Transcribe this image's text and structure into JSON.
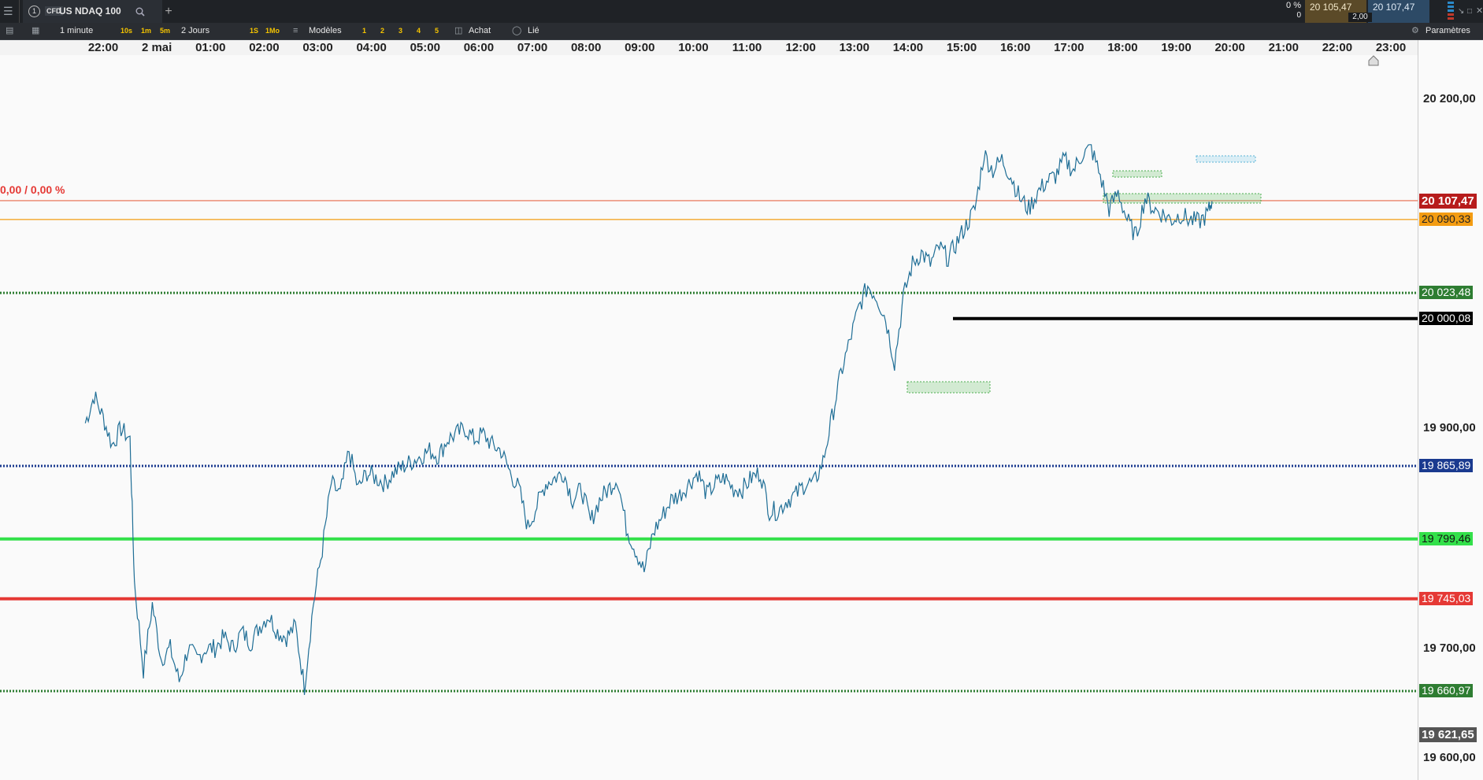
{
  "instrument": {
    "type_badge": "CFD",
    "name": "US NDAQ 100",
    "add_tab": "+"
  },
  "quote": {
    "change_pct": "0 %",
    "change_abs": "0",
    "bid": "20 105,47",
    "ask": "20 107,47",
    "spread": "2,00"
  },
  "toolbar": {
    "interval": "1 minute",
    "quick_intervals": [
      "10s",
      "1m",
      "5m"
    ],
    "range": "2 Jours",
    "quick_ranges": [
      "1S",
      "1Mo"
    ],
    "templates_label": "Modèles",
    "layouts": [
      "1",
      "2",
      "3",
      "4",
      "5"
    ],
    "buy_label": "Achat",
    "link_label": "Lié",
    "settings_label": "Paramètres"
  },
  "time_axis": [
    "22:00",
    "2 mai",
    "01:00",
    "02:00",
    "03:00",
    "04:00",
    "05:00",
    "06:00",
    "07:00",
    "08:00",
    "09:00",
    "10:00",
    "11:00",
    "12:00",
    "13:00",
    "14:00",
    "15:00",
    "16:00",
    "17:00",
    "18:00",
    "19:00",
    "20:00",
    "21:00",
    "22:00",
    "23:00"
  ],
  "price_axis": [
    "20 200,00",
    "19 900,00",
    "19 700,00",
    "19 600,00"
  ],
  "change_readout": "0,00 / 0,00 %",
  "levels": [
    {
      "price": 20107.47,
      "label": "20 107,47",
      "style": "last",
      "line": "#e8694a",
      "tag_bg": "#b71c1c",
      "tag_fg": "#ffffff"
    },
    {
      "price": 20090.33,
      "label": "20 090,33",
      "style": "solid-thin",
      "line": "#f39c12",
      "tag_bg": "#f39c12",
      "tag_fg": "#222222"
    },
    {
      "price": 20023.48,
      "label": "20 023,48",
      "style": "dotted",
      "line": "#2e7d32",
      "tag_bg": "#2e7d32",
      "tag_fg": "#ffffff"
    },
    {
      "price": 20000.08,
      "label": "20 000,08",
      "style": "solid-thick",
      "line": "#000000",
      "tag_bg": "#000000",
      "tag_fg": "#ffffff"
    },
    {
      "price": 19865.89,
      "label": "19 865,89",
      "style": "dotted",
      "line": "#1a3a8f",
      "tag_bg": "#1a3a8f",
      "tag_fg": "#ffffff"
    },
    {
      "price": 19799.46,
      "label": "19 799,46",
      "style": "solid-thick",
      "line": "#33e04a",
      "tag_bg": "#33e04a",
      "tag_fg": "#111111"
    },
    {
      "price": 19745.03,
      "label": "19 745,03",
      "style": "solid-thick",
      "line": "#e53935",
      "tag_bg": "#e53935",
      "tag_fg": "#ffffff"
    },
    {
      "price": 19660.97,
      "label": "19 660,97",
      "style": "dotted",
      "line": "#2e7d32",
      "tag_bg": "#2e7d32",
      "tag_fg": "#ffffff"
    },
    {
      "price": 19621.65,
      "label": "19 621,65",
      "style": "tag-only",
      "line": "#555555",
      "tag_bg": "#555555",
      "tag_fg": "#ffffff"
    }
  ],
  "chart_data": {
    "type": "line",
    "series": [
      {
        "name": "US NDAQ 100",
        "color": "#1f6e96",
        "points": [
          [
            "21:40",
            19905
          ],
          [
            "21:50",
            19930
          ],
          [
            "22:00",
            19910
          ],
          [
            "22:10",
            19885
          ],
          [
            "22:20",
            19900
          ],
          [
            "22:30",
            19890
          ],
          [
            "22:35",
            19760
          ],
          [
            "22:45",
            19680
          ],
          [
            "22:55",
            19740
          ],
          [
            "23:05",
            19690
          ],
          [
            "23:15",
            19700
          ],
          [
            "23:25",
            19670
          ],
          [
            "23:35",
            19700
          ],
          [
            "23:45",
            19690
          ],
          [
            "23:55",
            19700
          ],
          [
            "00:05",
            19700
          ],
          [
            "00:15",
            19710
          ],
          [
            "00:25",
            19700
          ],
          [
            "00:35",
            19715
          ],
          [
            "00:45",
            19705
          ],
          [
            "00:55",
            19720
          ],
          [
            "01:05",
            19730
          ],
          [
            "01:15",
            19715
          ],
          [
            "01:25",
            19710
          ],
          [
            "01:35",
            19720
          ],
          [
            "01:45",
            19665
          ],
          [
            "01:55",
            19740
          ],
          [
            "02:05",
            19790
          ],
          [
            "02:15",
            19850
          ],
          [
            "02:25",
            19840
          ],
          [
            "02:35",
            19880
          ],
          [
            "02:45",
            19845
          ],
          [
            "02:55",
            19860
          ],
          [
            "03:05",
            19855
          ],
          [
            "03:15",
            19850
          ],
          [
            "03:25",
            19860
          ],
          [
            "03:35",
            19865
          ],
          [
            "03:45",
            19870
          ],
          [
            "03:55",
            19875
          ],
          [
            "04:05",
            19880
          ],
          [
            "04:15",
            19875
          ],
          [
            "04:25",
            19890
          ],
          [
            "04:35",
            19895
          ],
          [
            "04:45",
            19900
          ],
          [
            "04:55",
            19890
          ],
          [
            "05:05",
            19895
          ],
          [
            "05:15",
            19885
          ],
          [
            "05:25",
            19880
          ],
          [
            "05:35",
            19860
          ],
          [
            "05:45",
            19845
          ],
          [
            "05:55",
            19810
          ],
          [
            "06:05",
            19830
          ],
          [
            "06:15",
            19850
          ],
          [
            "06:25",
            19855
          ],
          [
            "06:35",
            19860
          ],
          [
            "06:45",
            19835
          ],
          [
            "06:55",
            19845
          ],
          [
            "07:05",
            19815
          ],
          [
            "07:15",
            19835
          ],
          [
            "07:25",
            19845
          ],
          [
            "07:35",
            19855
          ],
          [
            "07:45",
            19810
          ],
          [
            "07:55",
            19790
          ],
          [
            "08:05",
            19770
          ],
          [
            "08:15",
            19805
          ],
          [
            "08:25",
            19820
          ],
          [
            "08:35",
            19835
          ],
          [
            "08:45",
            19840
          ],
          [
            "08:55",
            19850
          ],
          [
            "09:05",
            19860
          ],
          [
            "09:15",
            19840
          ],
          [
            "09:25",
            19850
          ],
          [
            "09:35",
            19855
          ],
          [
            "09:45",
            19845
          ],
          [
            "09:55",
            19845
          ],
          [
            "10:05",
            19855
          ],
          [
            "10:15",
            19860
          ],
          [
            "10:25",
            19825
          ],
          [
            "10:35",
            19825
          ],
          [
            "10:45",
            19835
          ],
          [
            "10:55",
            19840
          ],
          [
            "11:05",
            19850
          ],
          [
            "11:15",
            19850
          ],
          [
            "11:25",
            19870
          ],
          [
            "11:35",
            19910
          ],
          [
            "11:45",
            19950
          ],
          [
            "11:55",
            19980
          ],
          [
            "12:05",
            20010
          ],
          [
            "12:15",
            20030
          ],
          [
            "12:25",
            20020
          ],
          [
            "12:35",
            20000
          ],
          [
            "12:45",
            19960
          ],
          [
            "12:55",
            20020
          ],
          [
            "13:05",
            20050
          ],
          [
            "13:15",
            20060
          ],
          [
            "13:25",
            20050
          ],
          [
            "13:35",
            20065
          ],
          [
            "13:45",
            20055
          ],
          [
            "13:55",
            20070
          ],
          [
            "14:05",
            20085
          ],
          [
            "14:15",
            20100
          ],
          [
            "14:25",
            20150
          ],
          [
            "14:35",
            20135
          ],
          [
            "14:45",
            20145
          ],
          [
            "14:55",
            20130
          ],
          [
            "15:05",
            20110
          ],
          [
            "15:15",
            20100
          ],
          [
            "15:25",
            20115
          ],
          [
            "15:35",
            20125
          ],
          [
            "15:45",
            20130
          ],
          [
            "15:55",
            20145
          ],
          [
            "16:05",
            20135
          ],
          [
            "16:15",
            20150
          ],
          [
            "16:25",
            20155
          ],
          [
            "16:35",
            20130
          ],
          [
            "16:45",
            20100
          ],
          [
            "16:55",
            20115
          ],
          [
            "17:05",
            20090
          ],
          [
            "17:15",
            20075
          ],
          [
            "17:25",
            20110
          ],
          [
            "17:35",
            20100
          ],
          [
            "17:45",
            20095
          ],
          [
            "17:55",
            20090
          ],
          [
            "18:05",
            20095
          ],
          [
            "18:15",
            20090
          ],
          [
            "18:25",
            20088
          ],
          [
            "18:35",
            20095
          ],
          [
            "18:40",
            20107
          ]
        ]
      }
    ],
    "xlim": [
      "21:40",
      "18:45"
    ],
    "ylim": [
      19580,
      20240
    ],
    "grid": false
  }
}
